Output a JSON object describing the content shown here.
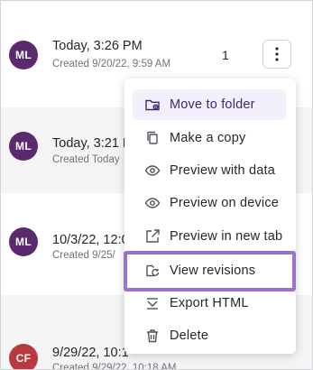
{
  "colors": {
    "accent": "#9b72c9",
    "avatar_ml": "#5b2a6e",
    "avatar_cf": "#b83a3f"
  },
  "rows": [
    {
      "initials": "ML",
      "title": "Today, 3:26 PM",
      "subtitle": "Created 9/20/22, 9:59 AM",
      "count": "1"
    },
    {
      "initials": "ML",
      "title": "Today, 3:21 P",
      "subtitle": "Created Today"
    },
    {
      "initials": "ML",
      "title": "10/3/22, 12:0",
      "subtitle": "Created 9/25/"
    },
    {
      "initials": "CF",
      "title": "9/29/22, 10:1",
      "subtitle": "Created 9/29/22, 10:18 AM"
    }
  ],
  "menu": {
    "items": [
      {
        "label": "Move to folder",
        "icon": "folder-move-icon"
      },
      {
        "label": "Make a copy",
        "icon": "copy-icon"
      },
      {
        "label": "Preview with data",
        "icon": "eye-icon"
      },
      {
        "label": "Preview on device",
        "icon": "eye-icon"
      },
      {
        "label": "Preview in new tab",
        "icon": "external-link-icon"
      },
      {
        "label": "View revisions",
        "icon": "revisions-icon"
      },
      {
        "label": "Export HTML",
        "icon": "export-icon"
      },
      {
        "label": "Delete",
        "icon": "trash-icon"
      }
    ]
  }
}
